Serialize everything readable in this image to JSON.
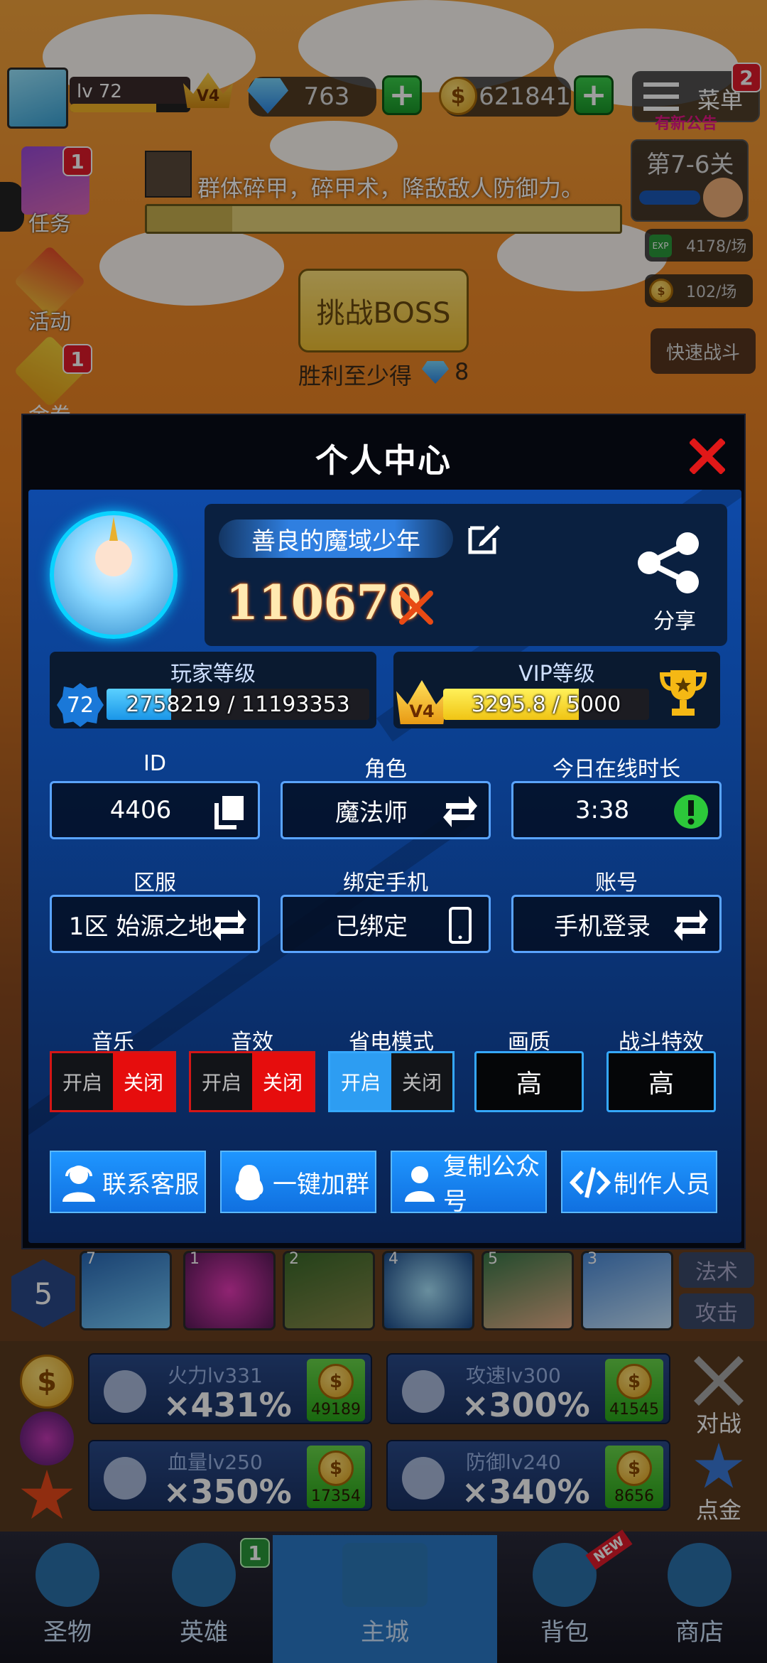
{
  "hud": {
    "level": "lv 72",
    "vip": "V4",
    "gems": "763",
    "coins": "621841",
    "menu_label": "菜单",
    "menu_badge": "2",
    "notice_label": "有新公告",
    "stage": "第7-6关",
    "exp_rate": "4178/场",
    "coin_rate": "102/场",
    "quick_battle": "快速战斗"
  },
  "left_menu": {
    "quest_badge": "1",
    "quest_label": "任务",
    "event_label": "活动",
    "ticket_badge": "1",
    "ticket_label": "金卷"
  },
  "boss": {
    "quest_text": "群体碎甲，碎甲术，降敌敌人防御力。",
    "button": "挑战BOSS",
    "reward_text": "胜利至少得",
    "reward_value": "8"
  },
  "modal": {
    "title": "个人中心",
    "player_name": "善良的魔域少年",
    "power": "110670",
    "share_label": "分享",
    "player_level": {
      "title": "玩家等级",
      "level": "72",
      "progress_text": "2758219 / 11193353",
      "progress": 0.2464
    },
    "vip_level": {
      "title": "VIP等级",
      "level": "V4",
      "progress_text": "3295.8 / 5000",
      "progress": 0.6592
    },
    "fields": [
      {
        "label": "ID",
        "value": "4406",
        "icon": "copy-icon"
      },
      {
        "label": "角色",
        "value": "魔法师",
        "icon": "swap-icon"
      },
      {
        "label": "今日在线时长",
        "value": "3:38",
        "icon": "alert-icon"
      },
      {
        "label": "区服",
        "value": "1区 始源之地",
        "icon": "swap-icon"
      },
      {
        "label": "绑定手机",
        "value": "已绑定",
        "icon": "phone-icon"
      },
      {
        "label": "账号",
        "value": "手机登录",
        "icon": "swap-icon"
      }
    ],
    "toggles": [
      {
        "label": "音乐",
        "on": "开启",
        "off": "关闭",
        "state": "off"
      },
      {
        "label": "音效",
        "on": "开启",
        "off": "关闭",
        "state": "off"
      },
      {
        "label": "省电模式",
        "on": "开启",
        "off": "关闭",
        "state": "on"
      }
    ],
    "quality": [
      {
        "label": "画质",
        "value": "高"
      },
      {
        "label": "战斗特效",
        "value": "高"
      }
    ],
    "buttons": [
      {
        "label": "联系客服",
        "icon": "support-agent-icon"
      },
      {
        "label": "一键加群",
        "icon": "qq-penguin-icon"
      },
      {
        "label": "复制公众号",
        "icon": "user-icon"
      },
      {
        "label": "制作人员",
        "icon": "code-icon"
      }
    ]
  },
  "skills": {
    "counts": [
      "7",
      "1",
      "2",
      "4",
      "5",
      "3"
    ],
    "slot_level": "5",
    "magic_tab": "法术",
    "attack_tab": "攻击"
  },
  "upgrades": [
    {
      "name": "火力lv331",
      "mult": "×431%",
      "cost": "49189"
    },
    {
      "name": "攻速lv300",
      "mult": "×300%",
      "cost": "41545"
    },
    {
      "name": "血量lv250",
      "mult": "×350%",
      "cost": "17354"
    },
    {
      "name": "防御lv240",
      "mult": "×340%",
      "cost": "8656"
    }
  ],
  "side_actions": {
    "battle": "对战",
    "gold": "点金"
  },
  "tabs": [
    {
      "label": "圣物"
    },
    {
      "label": "英雄",
      "badge": "1"
    },
    {
      "label": "主城"
    },
    {
      "label": "背包",
      "tag": "NEW"
    },
    {
      "label": "商店"
    }
  ],
  "colors": {
    "accent_blue": "#1f96ff",
    "toggle_off_red": "#e60d0d",
    "close_red": "#e01818",
    "vip_gold": "#ffd21a"
  }
}
